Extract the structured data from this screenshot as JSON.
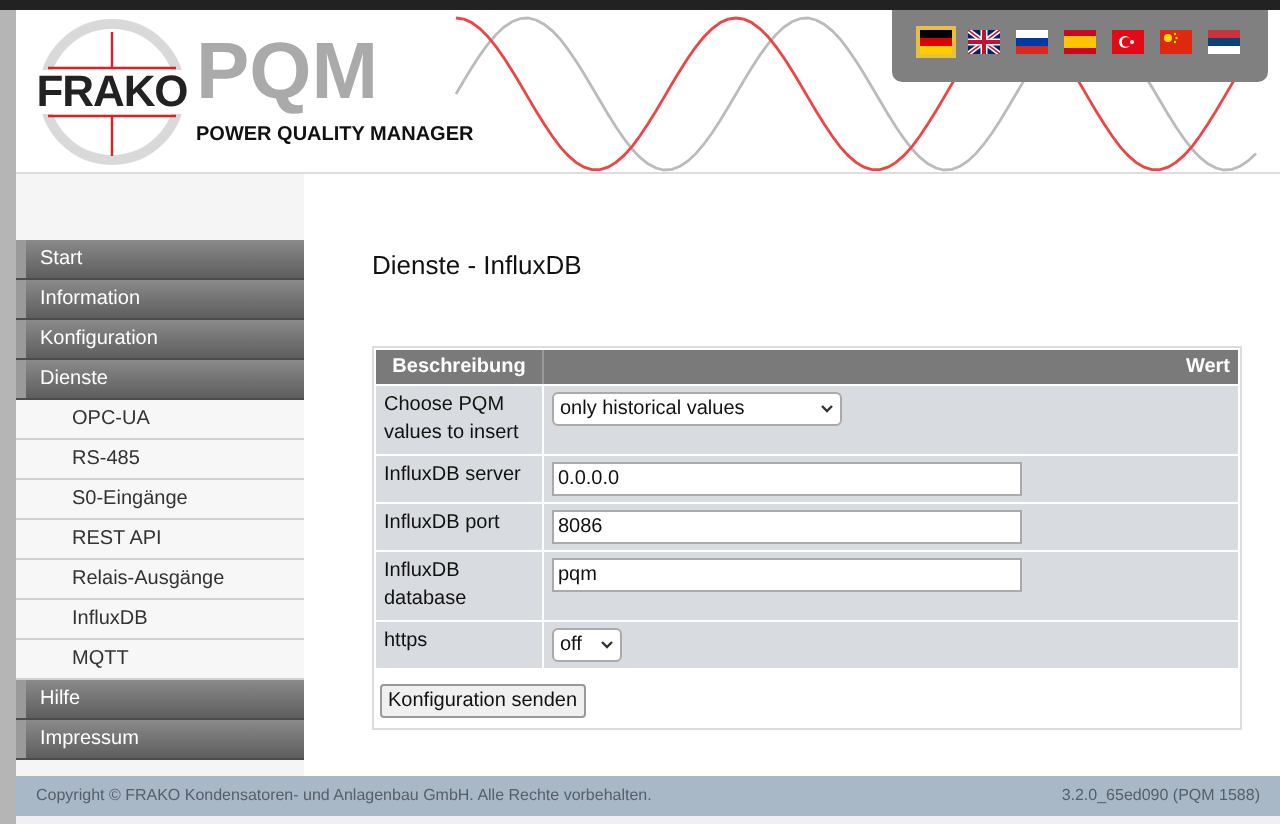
{
  "header": {
    "brand": "FRAKO",
    "product": "PQM",
    "subtitle": "POWER QUALITY MANAGER"
  },
  "language_flags": [
    {
      "kind": "de",
      "selected": true
    },
    {
      "kind": "gb",
      "selected": false
    },
    {
      "kind": "ru",
      "selected": false
    },
    {
      "kind": "es",
      "selected": false
    },
    {
      "kind": "tr",
      "selected": false
    },
    {
      "kind": "cn",
      "selected": false
    },
    {
      "kind": "rs",
      "selected": false
    }
  ],
  "sidebar": {
    "items": [
      {
        "label": "Start"
      },
      {
        "label": "Information"
      },
      {
        "label": "Konfiguration"
      },
      {
        "label": "Dienste",
        "children": [
          {
            "label": "OPC-UA"
          },
          {
            "label": "RS-485"
          },
          {
            "label": "S0-Eingänge"
          },
          {
            "label": "REST API"
          },
          {
            "label": "Relais-Ausgänge"
          },
          {
            "label": "InfluxDB"
          },
          {
            "label": "MQTT"
          }
        ]
      },
      {
        "label": "Hilfe"
      },
      {
        "label": "Impressum"
      }
    ]
  },
  "page_title": "Dienste - InfluxDB",
  "table": {
    "columns": [
      "Beschreibung",
      "Wert"
    ],
    "rows": [
      {
        "label": "Choose PQM values to insert",
        "kind": "select",
        "value": "only historical values"
      },
      {
        "label": "InfluxDB server",
        "kind": "text",
        "value": "0.0.0.0"
      },
      {
        "label": "InfluxDB port",
        "kind": "text",
        "value": "8086"
      },
      {
        "label": "InfluxDB database",
        "kind": "text",
        "value": "pqm"
      },
      {
        "label": "https",
        "kind": "select-small",
        "value": "off"
      }
    ],
    "submit": "Konfiguration senden"
  },
  "footer": {
    "copyright": "Copyright © FRAKO Kondensatoren- und Anlagenbau GmbH. Alle Rechte vorbehalten.",
    "version": "3.2.0_65ed090 (PQM 1588)"
  }
}
